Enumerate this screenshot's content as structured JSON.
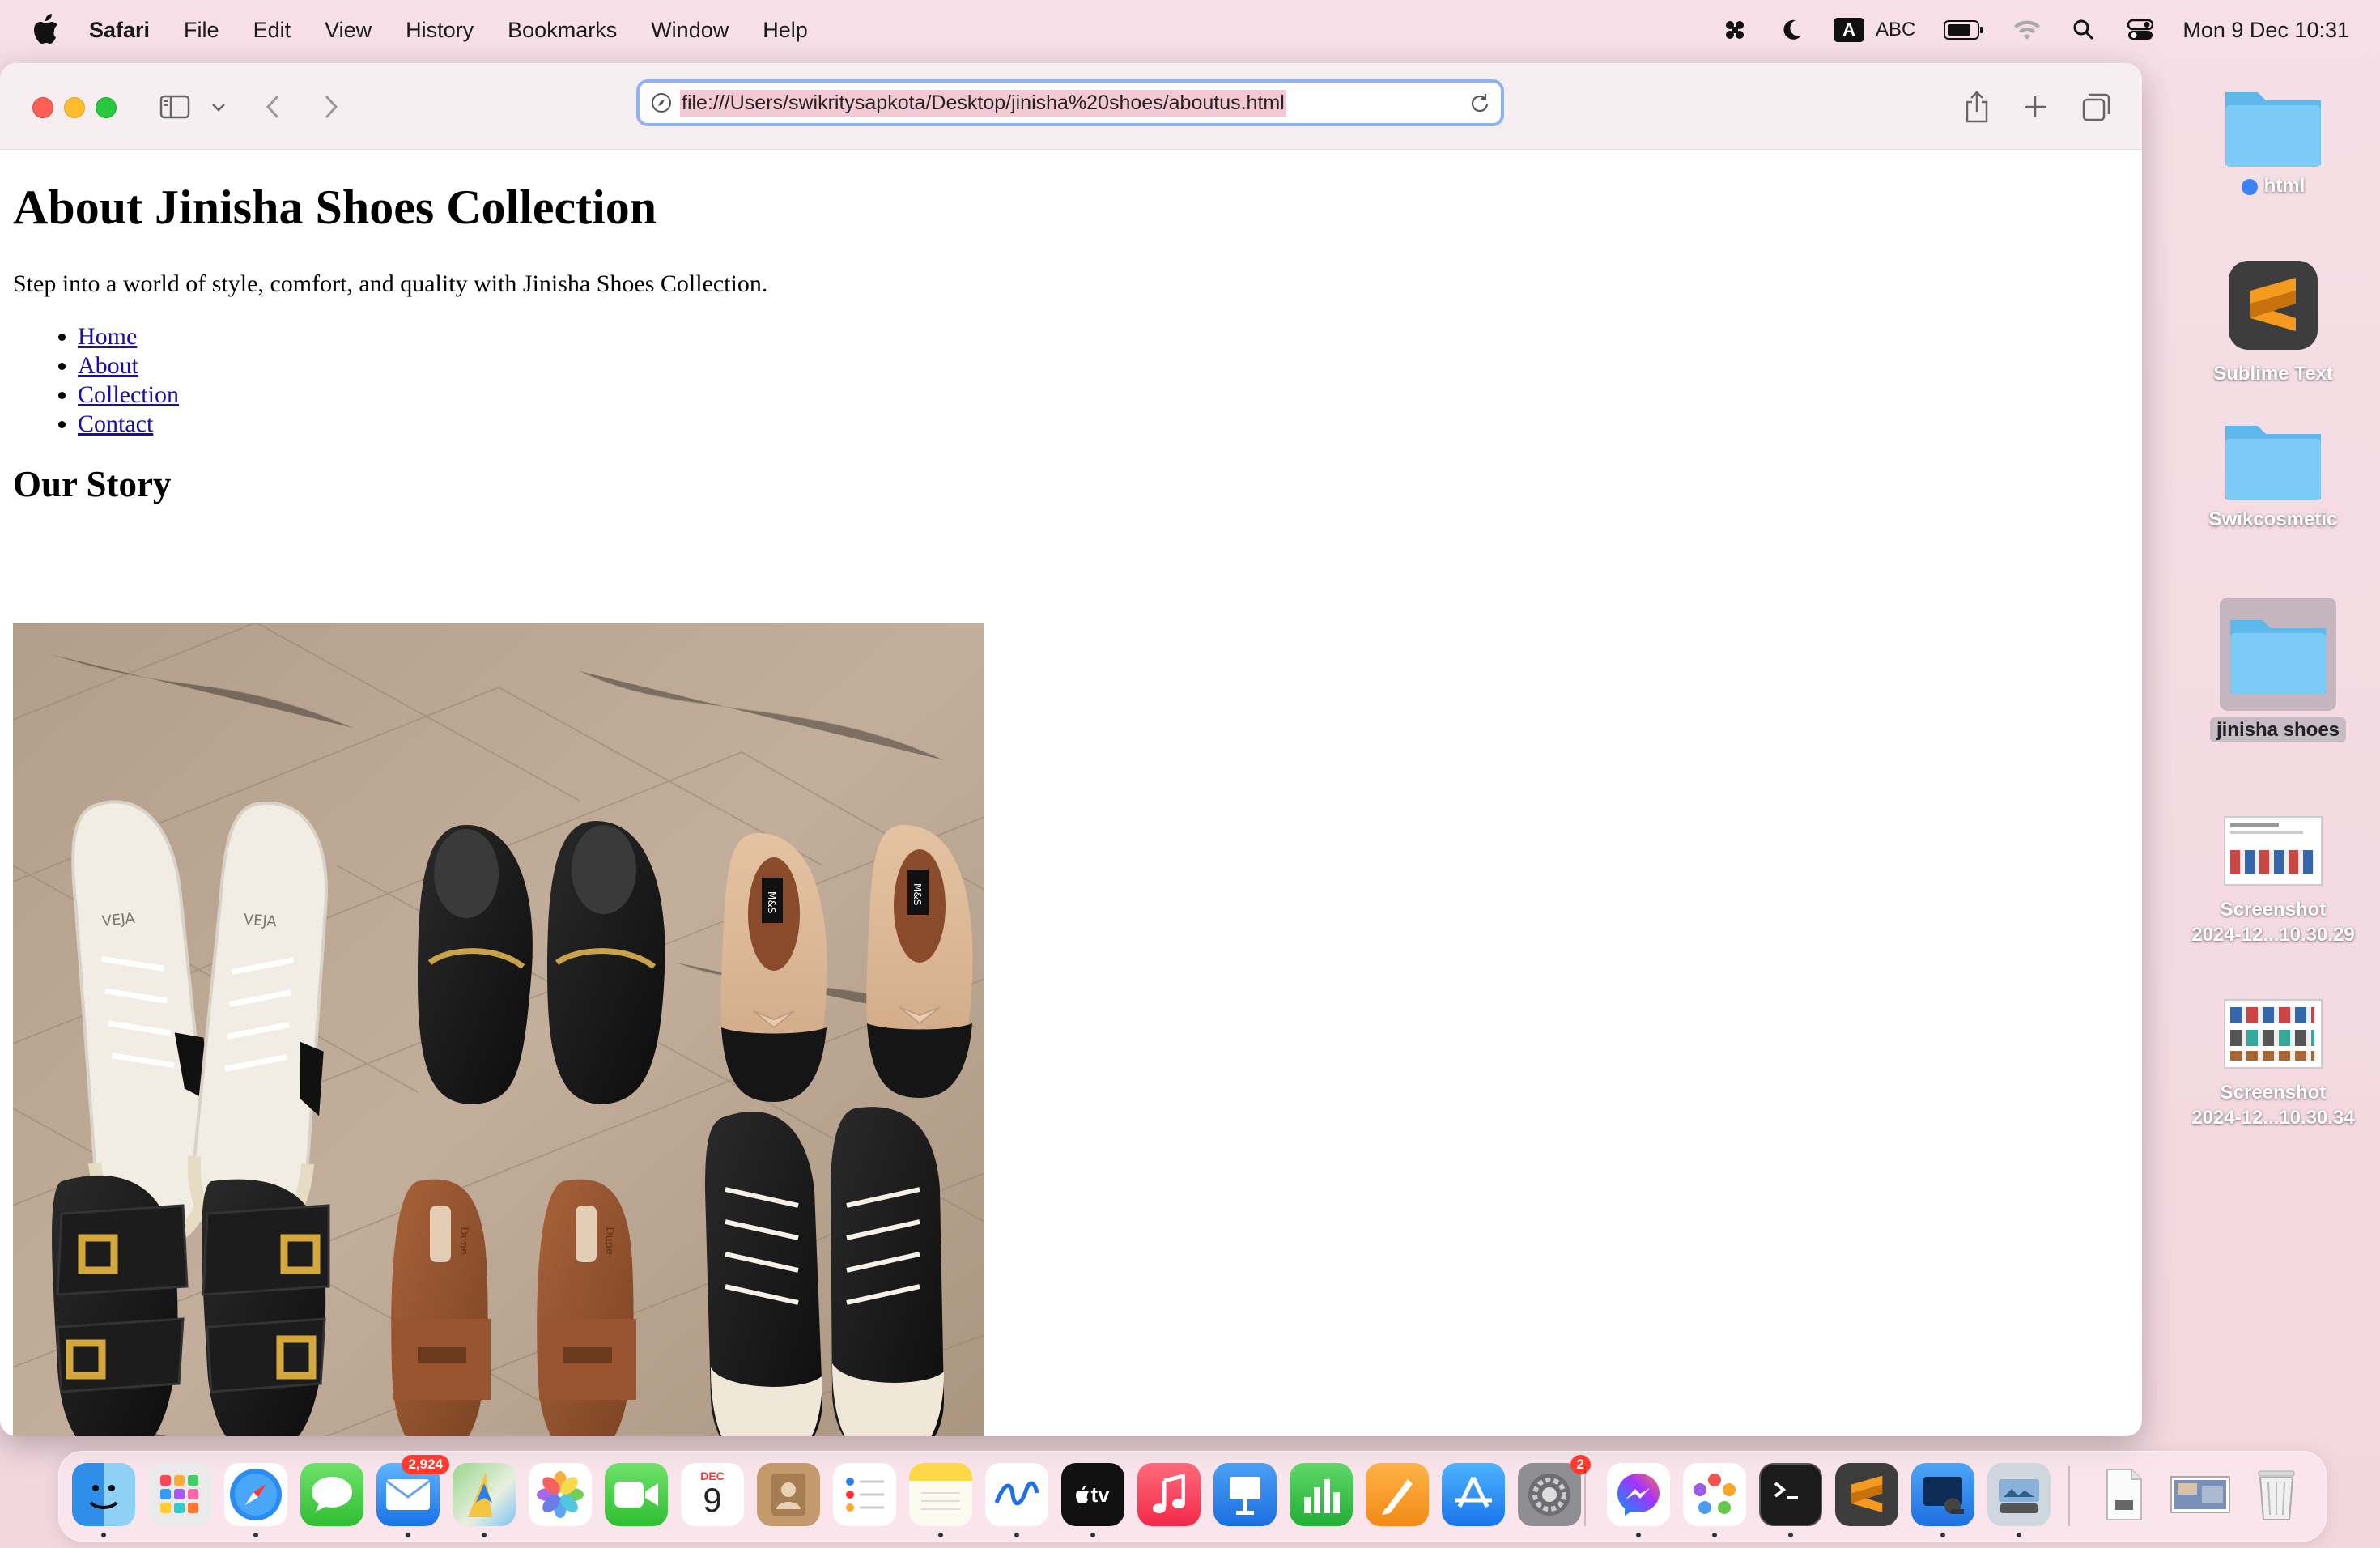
{
  "menubar": {
    "app_name": "Safari",
    "items": [
      "File",
      "Edit",
      "View",
      "History",
      "Bookmarks",
      "Window",
      "Help"
    ],
    "input_source": "A",
    "input_label": "ABC",
    "clock": "Mon 9 Dec  10:31"
  },
  "browser": {
    "url": "file:///Users/swikritysapkota/Desktop/jinisha%20shoes/aboutus.html"
  },
  "page": {
    "title": "About Jinisha Shoes Collection",
    "lead": "Step into a world of style, comfort, and quality with Jinisha Shoes Collection.",
    "nav": [
      "Home",
      "About",
      "Collection",
      "Contact"
    ],
    "section_heading": "Our Story",
    "shoe_labels": {
      "veja_left": "VEJA",
      "veja_right": "VEJA",
      "mas_left": "M&S",
      "mas_right": "M&S",
      "dune_left": "Dune",
      "dune_right": "Dune"
    }
  },
  "desktop": {
    "icons": [
      {
        "label": "html",
        "kind": "folder",
        "tag_color": "#3b82f6"
      },
      {
        "label": "Sublime Text",
        "kind": "app"
      },
      {
        "label": "Swikcosmetic",
        "kind": "folder"
      },
      {
        "label": "jinisha shoes",
        "kind": "folder",
        "selected": true
      },
      {
        "label": "Screenshot",
        "label2": "2024-12...10.30.29",
        "kind": "screenshot"
      },
      {
        "label": "Screenshot",
        "label2": "2024-12...10.30.34",
        "kind": "screenshot"
      }
    ]
  },
  "dock": {
    "mail_badge": "2,924",
    "calendar_month": "DEC",
    "calendar_day": "9",
    "settings_badge": "2",
    "tv_label": "tv"
  }
}
